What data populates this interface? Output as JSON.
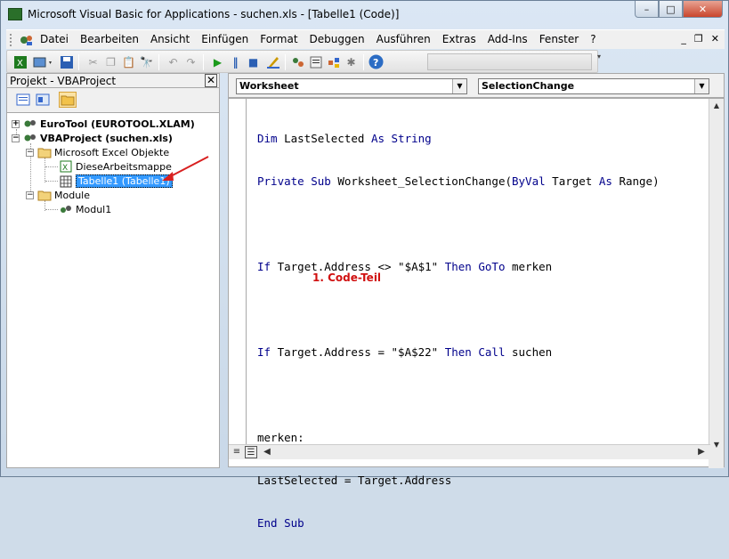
{
  "window": {
    "title": "Microsoft Visual Basic for Applications - suchen.xls - [Tabelle1 (Code)]"
  },
  "caption": {
    "minimize": "–",
    "maximize": "□",
    "close": "✕"
  },
  "menu": {
    "items": [
      "Datei",
      "Bearbeiten",
      "Ansicht",
      "Einfügen",
      "Format",
      "Debuggen",
      "Ausführen",
      "Extras",
      "Add-Ins",
      "Fenster",
      "?"
    ],
    "mdi": {
      "minimize": "_",
      "restore": "❐",
      "close": "✕"
    }
  },
  "toolbar": {
    "icons": [
      "excel-icon",
      "insert-module-icon",
      "save-icon",
      "cut-icon",
      "copy-icon",
      "paste-icon",
      "find-icon",
      "undo-icon",
      "redo-icon",
      "run-icon",
      "break-icon",
      "reset-icon",
      "design-mode-icon",
      "project-explorer-icon",
      "properties-icon",
      "object-browser-icon",
      "toolbox-icon",
      "help-icon"
    ]
  },
  "project_pane": {
    "title": "Projekt - VBAProject",
    "close": "✕",
    "tree": [
      {
        "label": "EuroTool (EUROTOOL.XLAM)",
        "bold": true,
        "expander": "+"
      },
      {
        "label": "VBAProject (suchen.xls)",
        "bold": true,
        "expander": "−"
      },
      {
        "label": "Microsoft Excel Objekte",
        "expander": "−"
      },
      {
        "label": "DieseArbeitsmappe"
      },
      {
        "label": "Tabelle1 (Tabelle1)",
        "selected": true
      },
      {
        "label": "Module",
        "expander": "−"
      },
      {
        "label": "Modul1"
      }
    ]
  },
  "code_window": {
    "object_combo": "Worksheet",
    "procedure_combo": "SelectionChange",
    "lines": [
      "Dim LastSelected As String",
      "Private Sub Worksheet_SelectionChange(ByVal Target As Range)",
      "",
      "If Target.Address <> \"$A$1\" Then GoTo merken",
      "",
      "If Target.Address = \"$A$22\" Then Call suchen",
      "",
      "merken:",
      "LastSelected = Target.Address",
      "End Sub"
    ],
    "annotation": "1. Code-Teil"
  },
  "colors": {
    "keyword": "#00008b",
    "annotation": "#d01010",
    "selection": "#3399ff"
  }
}
